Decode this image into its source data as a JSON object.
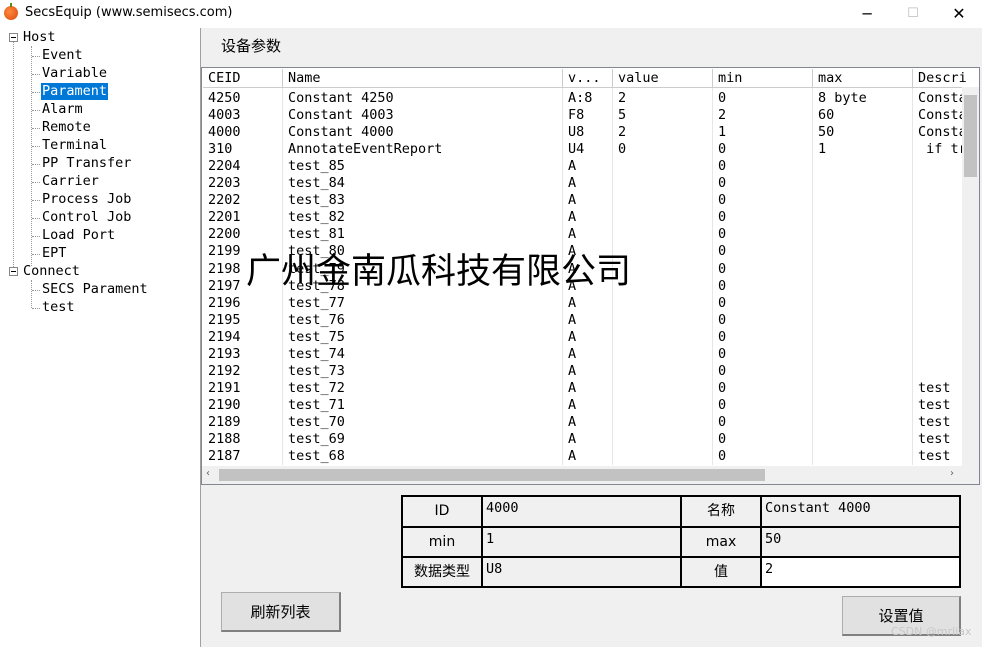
{
  "window": {
    "title": "SecsEquip   (www.semisecs.com)",
    "icon": "pumpkin-app-icon",
    "minimize": "─",
    "maximize": "☐",
    "close": "✕"
  },
  "tree": {
    "host": "Host",
    "host_items": [
      "Event",
      "Variable",
      "Parament",
      "Alarm",
      "Remote",
      "Terminal",
      "PP Transfer",
      "Carrier",
      "Process Job",
      "Control Job",
      "Load Port",
      "EPT"
    ],
    "selected": "Parament",
    "connect": "Connect",
    "connect_items": [
      "SECS Parament",
      "test"
    ]
  },
  "section_title": "设备参数",
  "table": {
    "headers": [
      "CEID",
      "Name",
      "v...",
      "value",
      "min",
      "max",
      "Descri"
    ],
    "rows": [
      [
        "4250",
        "Constant 4250",
        "A:8",
        "2",
        "0",
        "8 byte",
        "Consta"
      ],
      [
        "4003",
        "Constant 4003",
        "F8",
        "5",
        "2",
        "60",
        "Consta"
      ],
      [
        "4000",
        "Constant 4000",
        "U8",
        "2",
        "1",
        "50",
        "Consta"
      ],
      [
        "310",
        "AnnotateEventReport",
        "U4",
        "0",
        "0",
        "1",
        " if tr"
      ],
      [
        "2204",
        "test_85",
        "A",
        "",
        "0",
        "",
        ""
      ],
      [
        "2203",
        "test_84",
        "A",
        "",
        "0",
        "",
        ""
      ],
      [
        "2202",
        "test_83",
        "A",
        "",
        "0",
        "",
        ""
      ],
      [
        "2201",
        "test_82",
        "A",
        "",
        "0",
        "",
        ""
      ],
      [
        "2200",
        "test_81",
        "A",
        "",
        "0",
        "",
        ""
      ],
      [
        "2199",
        "test_80",
        "A",
        "",
        "0",
        "",
        ""
      ],
      [
        "2198",
        "test_79",
        "A",
        "",
        "0",
        "",
        ""
      ],
      [
        "2197",
        "test_78",
        "A",
        "",
        "0",
        "",
        ""
      ],
      [
        "2196",
        "test_77",
        "A",
        "",
        "0",
        "",
        ""
      ],
      [
        "2195",
        "test_76",
        "A",
        "",
        "0",
        "",
        ""
      ],
      [
        "2194",
        "test_75",
        "A",
        "",
        "0",
        "",
        ""
      ],
      [
        "2193",
        "test_74",
        "A",
        "",
        "0",
        "",
        ""
      ],
      [
        "2192",
        "test_73",
        "A",
        "",
        "0",
        "",
        ""
      ],
      [
        "2191",
        "test_72",
        "A",
        "",
        "0",
        "",
        "test"
      ],
      [
        "2190",
        "test_71",
        "A",
        "",
        "0",
        "",
        "test"
      ],
      [
        "2189",
        "test_70",
        "A",
        "",
        "0",
        "",
        "test"
      ],
      [
        "2188",
        "test_69",
        "A",
        "",
        "0",
        "",
        "test"
      ],
      [
        "2187",
        "test_68",
        "A",
        "",
        "0",
        "",
        "test"
      ]
    ]
  },
  "watermark": "广州金南瓜科技有限公司",
  "detail": {
    "id_label": "ID",
    "id_value": "4000",
    "name_label": "名称",
    "name_value": "Constant 4000",
    "min_label": "min",
    "min_value": "1",
    "max_label": "max",
    "max_value": "50",
    "type_label": "数据类型",
    "type_value": "U8",
    "value_label": "值",
    "value_value": "2"
  },
  "buttons": {
    "refresh": "刷新列表",
    "set_value": "设置值"
  },
  "credit": "CSDN @mrliax",
  "scroll_arrows": {
    "right": "›",
    "left": "‹"
  }
}
